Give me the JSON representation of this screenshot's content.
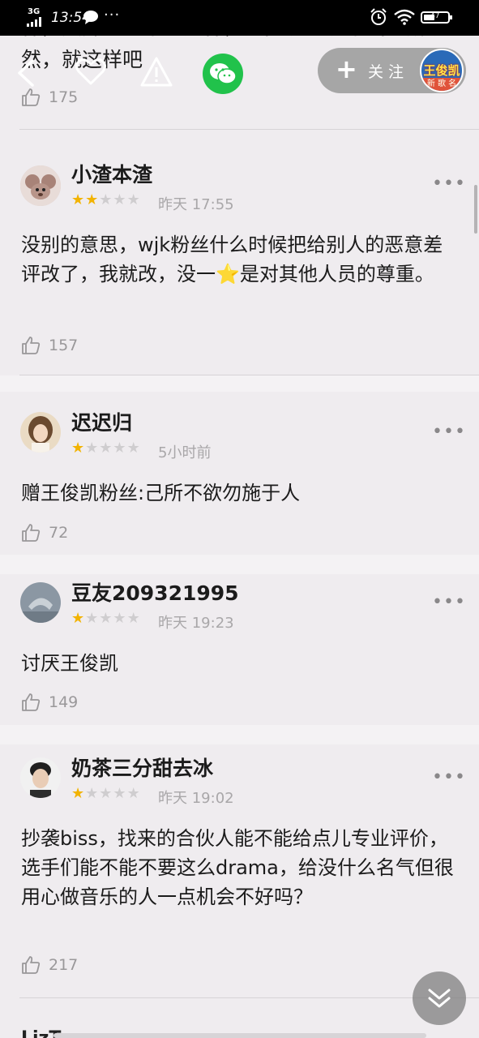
{
  "status_bar": {
    "network": "3G",
    "time": "13:54",
    "dots": "···",
    "battery_level": "47"
  },
  "nav": {
    "follow_label": "关注",
    "follow_avatar_title": "王俊凯",
    "follow_avatar_band": "新 歌 名"
  },
  "top_review": {
    "text": "样，然并的也不想这样，这把说也说不出个所以然，就这样吧",
    "likes": "175"
  },
  "reviews": [
    {
      "name": "小渣本渣",
      "rating": 2,
      "time": "昨天 17:55",
      "content": "没别的意思，wjk粉丝什么时候把给别人的恶意差评改了，我就改，没一⭐是对其他人员的尊重。",
      "likes": "157"
    },
    {
      "name": "迟迟归",
      "rating": 1,
      "time": "5小时前",
      "content": "赠王俊凯粉丝:己所不欲勿施于人",
      "likes": "72"
    },
    {
      "name": "豆友209321995",
      "rating": 1,
      "time": "昨天 19:23",
      "content": "讨厌王俊凯",
      "likes": "149"
    },
    {
      "name": "奶茶三分甜去冰",
      "rating": 1,
      "time": "昨天 19:02",
      "content": "抄袭biss，找来的合伙人能不能给点儿专业评价，选手们能不能不要这么drama，给没什么名气但很用心做音乐的人一点机会不好吗？",
      "likes": "217"
    }
  ],
  "peek_name": "LizTower",
  "colors": {
    "star_on": "#f2b300",
    "star_off": "#cfcdcf",
    "wechat_green": "#21c24b",
    "page_bg": "#efecef"
  }
}
